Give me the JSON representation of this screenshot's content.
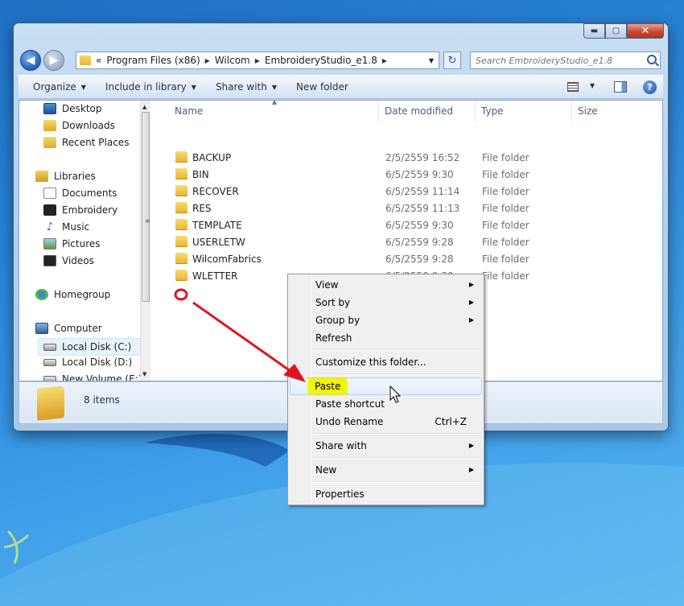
{
  "window": {
    "controls": {
      "minimize": "▬",
      "maximize": "▢",
      "close": "✕"
    }
  },
  "address": {
    "prefix": "«",
    "segments": [
      "Program Files (x86)",
      "Wilcom",
      "EmbroideryStudio_e1.8"
    ],
    "separator": "▶"
  },
  "search": {
    "placeholder": "Search EmbroideryStudio_e1.8"
  },
  "toolbar": {
    "organize": "Organize",
    "include_in_library": "Include in library",
    "share_with": "Share with",
    "new_folder": "New folder",
    "help": "?"
  },
  "sidebar": {
    "items": [
      {
        "label": "Desktop"
      },
      {
        "label": "Downloads"
      },
      {
        "label": "Recent Places"
      },
      {
        "label": "Libraries"
      },
      {
        "label": "Documents"
      },
      {
        "label": "Embroidery"
      },
      {
        "label": "Music"
      },
      {
        "label": "Pictures"
      },
      {
        "label": "Videos"
      },
      {
        "label": "Homegroup"
      },
      {
        "label": "Computer"
      },
      {
        "label": "Local Disk (C:)"
      },
      {
        "label": "Local Disk (D:)"
      },
      {
        "label": "New Volume (E:)"
      }
    ]
  },
  "columns": {
    "name": "Name",
    "date_modified": "Date modified",
    "type": "Type",
    "size": "Size"
  },
  "files": [
    {
      "name": "BACKUP",
      "date": "2/5/2559 16:52",
      "type": "File folder"
    },
    {
      "name": "BIN",
      "date": "6/5/2559 9:30",
      "type": "File folder"
    },
    {
      "name": "RECOVER",
      "date": "6/5/2559 11:14",
      "type": "File folder"
    },
    {
      "name": "RES",
      "date": "6/5/2559 11:13",
      "type": "File folder"
    },
    {
      "name": "TEMPLATE",
      "date": "6/5/2559 9:30",
      "type": "File folder"
    },
    {
      "name": "USERLETW",
      "date": "6/5/2559 9:28",
      "type": "File folder"
    },
    {
      "name": "WilcomFabrics",
      "date": "6/5/2559 9:28",
      "type": "File folder"
    },
    {
      "name": "WLETTER",
      "date": "6/5/2559 9:30",
      "type": "File folder"
    }
  ],
  "status": {
    "items_count": "8 items"
  },
  "context_menu": {
    "view": "View",
    "sort_by": "Sort by",
    "group_by": "Group by",
    "refresh": "Refresh",
    "customize": "Customize this folder...",
    "paste": "Paste",
    "paste_shortcut": "Paste shortcut",
    "undo_rename": "Undo Rename",
    "undo_shortcut": "Ctrl+Z",
    "share_with": "Share with",
    "new": "New",
    "properties": "Properties"
  },
  "colors": {
    "annotation_arrow": "#e0141b",
    "paste_highlight": "#f0f50c"
  }
}
